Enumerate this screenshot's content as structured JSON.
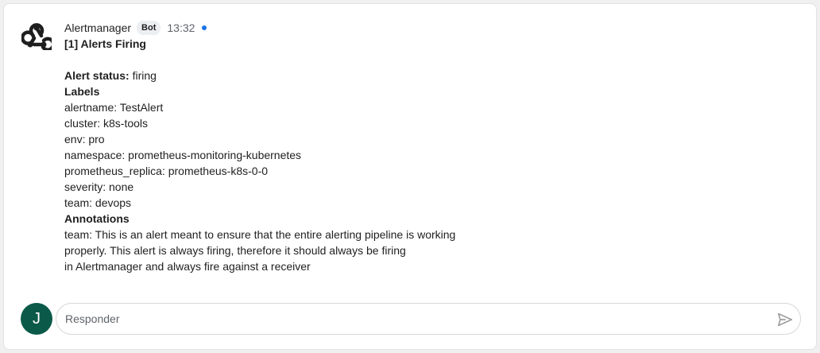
{
  "message": {
    "sender": "Alertmanager",
    "badge": "Bot",
    "time": "13:32",
    "title": "[1] Alerts Firing",
    "status_label": "Alert status:",
    "status_value": "firing",
    "labels_heading": "Labels",
    "labels": [
      "alertname: TestAlert",
      "cluster: k8s-tools",
      "env: pro",
      "namespace: prometheus-monitoring-kubernetes",
      "prometheus_replica: prometheus-k8s-0-0",
      "severity: none",
      "team: devops"
    ],
    "annotations_heading": "Annotations",
    "annotations": [
      "team: This is an alert meant to ensure that the entire alerting pipeline is working",
      "properly. This alert is always firing, therefore it should always be firing",
      "in Alertmanager and always fire against a receiver"
    ]
  },
  "reply": {
    "avatar_letter": "J",
    "placeholder": "Responder"
  },
  "icons": {
    "bot_avatar": "webhook-icon",
    "send": "send-icon",
    "unread": "unread-dot"
  },
  "colors": {
    "avatar_bg": "#0b5a49",
    "unread_dot": "#1a73e8"
  }
}
